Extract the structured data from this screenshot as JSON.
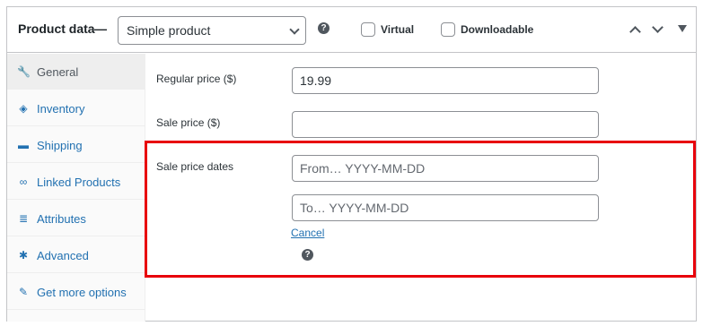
{
  "header": {
    "title": "Product data",
    "dash": "—",
    "product_type": "Simple product",
    "help_glyph": "?",
    "virtual_label": "Virtual",
    "downloadable_label": "Downloadable"
  },
  "sidebar": {
    "items": [
      {
        "label": "General",
        "icon": "wrench-icon",
        "glyph": "🔧"
      },
      {
        "label": "Inventory",
        "icon": "tag-icon",
        "glyph": "◈"
      },
      {
        "label": "Shipping",
        "icon": "truck-icon",
        "glyph": "▬"
      },
      {
        "label": "Linked Products",
        "icon": "link-icon",
        "glyph": "∞"
      },
      {
        "label": "Attributes",
        "icon": "list-icon",
        "glyph": "≣"
      },
      {
        "label": "Advanced",
        "icon": "gear-icon",
        "glyph": "✱"
      },
      {
        "label": "Get more options",
        "icon": "plugin-icon",
        "glyph": "✎"
      }
    ]
  },
  "form": {
    "regular_price_label": "Regular price ($)",
    "regular_price_value": "19.99",
    "sale_price_label": "Sale price ($)",
    "sale_price_value": "",
    "sale_dates_label": "Sale price dates",
    "from_placeholder": "From… YYYY-MM-DD",
    "to_placeholder": "To…  YYYY-MM-DD",
    "cancel_label": "Cancel",
    "help_glyph": "?"
  },
  "colors": {
    "highlight": "#e8000b",
    "link": "#2271b1"
  }
}
